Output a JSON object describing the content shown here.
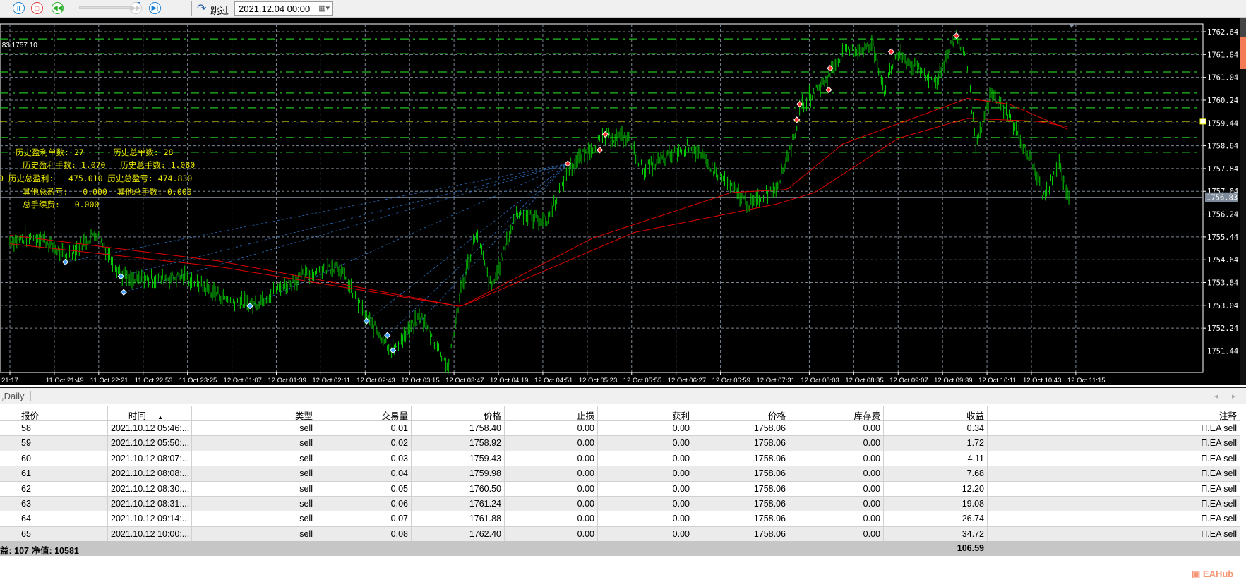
{
  "toolbar": {
    "skip_label": "跳过",
    "date_value": "2021.12.04 00:00"
  },
  "chart": {
    "ohlc_text": ".83 1757.10",
    "current_price": "1756.83",
    "current_price_value": 1756.83,
    "stats": [
      "历史盈利单数: 27      历史总单数: 28",
      "历史盈利手数: 1.070   历史总手数: 1.080",
      "0 历史总盈利:   475.010 历史总盈亏: 474.830",
      "其他总盈亏:   0.000  其他总手数: 0.000",
      "总手续费:   0.000"
    ],
    "price_labels": [
      "1762.64",
      "1761.84",
      "1761.04",
      "1760.24",
      "1759.44",
      "1758.64",
      "1757.84",
      "1757.04",
      "1756.24",
      "1755.44",
      "1754.64",
      "1753.84",
      "1753.04",
      "1752.24",
      "1751.44"
    ],
    "time_labels": [
      "21:17",
      "11 Oct 21:49",
      "11 Oct 22:21",
      "11 Oct 22:53",
      "11 Oct 23:25",
      "12 Oct 01:07",
      "12 Oct 01:39",
      "12 Oct 02:11",
      "12 Oct 02:43",
      "12 Oct 03:15",
      "12 Oct 03:47",
      "12 Oct 04:19",
      "12 Oct 04:51",
      "12 Oct 05:23",
      "12 Oct 05:55",
      "12 Oct 06:27",
      "12 Oct 06:59",
      "12 Oct 07:31",
      "12 Oct 08:03",
      "12 Oct 08:35",
      "12 Oct 09:07",
      "12 Oct 09:39",
      "12 Oct 10:11",
      "12 Oct 10:43",
      "12 Oct 11:15"
    ],
    "price_path": [
      [
        0,
        1755.31
      ],
      [
        22,
        1755.45
      ],
      [
        40,
        1754.75
      ],
      [
        62,
        1755.6
      ],
      [
        79,
        1754.2
      ],
      [
        87,
        1753.9
      ],
      [
        125,
        1754.05
      ],
      [
        159,
        1753.2
      ],
      [
        176,
        1753.08
      ],
      [
        193,
        1753.6
      ],
      [
        210,
        1754.05
      ],
      [
        236,
        1754.47
      ],
      [
        256,
        1752.66
      ],
      [
        276,
        1751.46
      ],
      [
        296,
        1752.66
      ],
      [
        316,
        1750.85
      ],
      [
        325,
        1753.6
      ],
      [
        336,
        1755.6
      ],
      [
        347,
        1753.6
      ],
      [
        365,
        1756.28
      ],
      [
        387,
        1756.0
      ],
      [
        402,
        1757.8
      ],
      [
        427,
        1758.93
      ],
      [
        445,
        1758.93
      ],
      [
        456,
        1757.8
      ],
      [
        490,
        1758.65
      ],
      [
        507,
        1757.8
      ],
      [
        533,
        1756.56
      ],
      [
        553,
        1757.26
      ],
      [
        565,
        1758.93
      ],
      [
        570,
        1760.05
      ],
      [
        587,
        1760.88
      ],
      [
        599,
        1761.86
      ],
      [
        622,
        1762.14
      ],
      [
        630,
        1760.6
      ],
      [
        639,
        1761.86
      ],
      [
        667,
        1760.88
      ],
      [
        682,
        1762.55
      ],
      [
        690,
        1761.44
      ],
      [
        696,
        1758.52
      ],
      [
        707,
        1760.47
      ],
      [
        719,
        1759.77
      ],
      [
        736,
        1758.1
      ],
      [
        745,
        1756.84
      ],
      [
        756,
        1757.96
      ],
      [
        763,
        1756.84
      ]
    ],
    "ma_fast": [
      [
        0,
        1755.5
      ],
      [
        150,
        1754.6
      ],
      [
        325,
        1753.0
      ],
      [
        420,
        1755.4
      ],
      [
        520,
        1757.0
      ],
      [
        560,
        1757.1
      ],
      [
        600,
        1758.7
      ],
      [
        690,
        1760.3
      ],
      [
        720,
        1760.1
      ],
      [
        763,
        1759.2
      ]
    ],
    "ma_slow": [
      [
        0,
        1755.2
      ],
      [
        150,
        1754.4
      ],
      [
        325,
        1753.0
      ],
      [
        450,
        1755.6
      ],
      [
        553,
        1756.6
      ],
      [
        580,
        1757.0
      ],
      [
        640,
        1758.9
      ],
      [
        690,
        1759.6
      ],
      [
        740,
        1759.5
      ],
      [
        763,
        1759.3
      ]
    ],
    "grid_levels": [
      1762.39,
      1761.87,
      1761.23,
      1760.49,
      1759.97,
      1758.93,
      1758.41
    ],
    "yellow_level": 1759.5,
    "buy_markers": [
      [
        40,
        1754.56
      ],
      [
        80,
        1754.06
      ],
      [
        82,
        1753.5
      ],
      [
        173,
        1753.02
      ],
      [
        257,
        1752.49
      ],
      [
        272,
        1751.99
      ],
      [
        276,
        1751.46
      ]
    ],
    "sell_markers": [
      [
        402,
        1758.01
      ],
      [
        425,
        1758.49
      ],
      [
        429,
        1759.04
      ],
      [
        567,
        1759.55
      ],
      [
        569,
        1760.1
      ],
      [
        590,
        1760.6
      ],
      [
        591,
        1761.36
      ],
      [
        635,
        1761.94
      ],
      [
        682,
        1762.5
      ]
    ],
    "colors": {
      "bars": "#00d000",
      "ma": "#e00000",
      "grid": "#7a8591",
      "level": "#22c022",
      "yellow": "#ffff00",
      "buy": "#3fa0ff",
      "sell": "#ff3030"
    }
  },
  "tabs": {
    "daily": ",Daily"
  },
  "table": {
    "headers": [
      "报价",
      "时间",
      "类型",
      "交易量",
      "价格",
      "止损",
      "获利",
      "价格",
      "库存费",
      "收益",
      "注释"
    ],
    "rows": [
      [
        "58",
        "2021.10.12 05:46:...",
        "sell",
        "0.01",
        "1758.40",
        "0.00",
        "0.00",
        "1758.06",
        "0.00",
        "0.34",
        "Π.EA sell"
      ],
      [
        "59",
        "2021.10.12 05:50:...",
        "sell",
        "0.02",
        "1758.92",
        "0.00",
        "0.00",
        "1758.06",
        "0.00",
        "1.72",
        "Π.EA sell"
      ],
      [
        "60",
        "2021.10.12 08:07:...",
        "sell",
        "0.03",
        "1759.43",
        "0.00",
        "0.00",
        "1758.06",
        "0.00",
        "4.11",
        "Π.EA sell"
      ],
      [
        "61",
        "2021.10.12 08:08:...",
        "sell",
        "0.04",
        "1759.98",
        "0.00",
        "0.00",
        "1758.06",
        "0.00",
        "7.68",
        "Π.EA sell"
      ],
      [
        "62",
        "2021.10.12 08:30:...",
        "sell",
        "0.05",
        "1760.50",
        "0.00",
        "0.00",
        "1758.06",
        "0.00",
        "12.20",
        "Π.EA sell"
      ],
      [
        "63",
        "2021.10.12 08:31:...",
        "sell",
        "0.06",
        "1761.24",
        "0.00",
        "0.00",
        "1758.06",
        "0.00",
        "19.08",
        "Π.EA sell"
      ],
      [
        "64",
        "2021.10.12 09:14:...",
        "sell",
        "0.07",
        "1761.88",
        "0.00",
        "0.00",
        "1758.06",
        "0.00",
        "26.74",
        "Π.EA sell"
      ],
      [
        "65",
        "2021.10.12 10:00:...",
        "sell",
        "0.08",
        "1762.40",
        "0.00",
        "0.00",
        "1758.06",
        "0.00",
        "34.72",
        "Π.EA sell"
      ]
    ],
    "summary_left": "益: 107   净值: 10581",
    "summary_total": "106.59"
  },
  "watermark": "EAHub"
}
